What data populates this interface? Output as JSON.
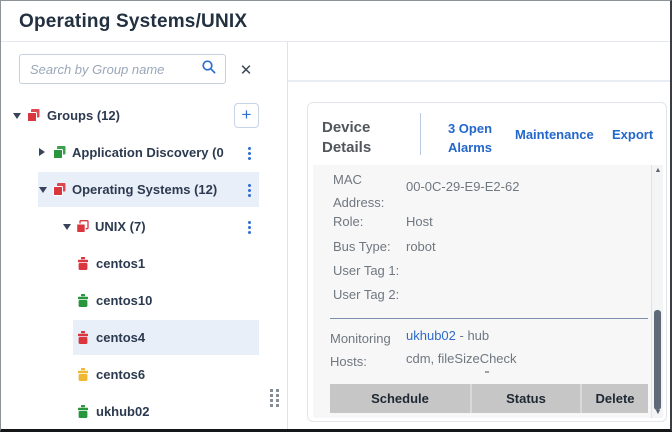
{
  "page_title": "Operating Systems/UNIX",
  "sidebar": {
    "search_placeholder": "Search by Group name",
    "tree": [
      {
        "label": "Groups (12)",
        "status": "red",
        "state": "expanded",
        "selected": false
      },
      {
        "label": "Application Discovery (0",
        "status": "green",
        "state": "collapsed",
        "selected": false
      },
      {
        "label": "Operating Systems (12)",
        "status": "red",
        "state": "expanded",
        "selected": true
      },
      {
        "label": "UNIX (7)",
        "status": "red",
        "state": "expanded",
        "selected": false
      },
      {
        "label": "centos1",
        "status": "red",
        "state": "leaf",
        "selected": false
      },
      {
        "label": "centos10",
        "status": "green",
        "state": "leaf",
        "selected": false
      },
      {
        "label": "centos4",
        "status": "red",
        "state": "leaf",
        "selected": true
      },
      {
        "label": "centos6",
        "status": "yellow",
        "state": "leaf",
        "selected": false
      },
      {
        "label": "ukhub02",
        "status": "green",
        "state": "leaf",
        "selected": false
      }
    ]
  },
  "device_panel": {
    "title": "Device Details",
    "open_alarms_link": "3 Open Alarms",
    "maintenance_link": "Maintenance",
    "export_link": "Export",
    "fields": [
      {
        "label": "MAC Address:",
        "value": "00-0C-29-E9-E2-62"
      },
      {
        "label": "Role:",
        "value": "Host"
      },
      {
        "label": "Bus Type:",
        "value": "robot"
      },
      {
        "label": "User Tag 1:",
        "value": ""
      },
      {
        "label": "User Tag 2:",
        "value": ""
      }
    ],
    "monitoring": {
      "label": "Monitoring Hosts:",
      "host": "ukhub02",
      "suffix": " - hub",
      "probes": "cdm, fileSizeCheck"
    },
    "table_headers": [
      "Schedule",
      "Status",
      "Delete"
    ]
  },
  "icons": {
    "clear_icon": "✕",
    "add_icon": "+",
    "scroll_up_icon": "▲",
    "scroll_down_icon": "▼"
  },
  "colors": {
    "title_text": "#22303f",
    "link_blue": "#2467cb",
    "accent_blue": "#2e6fd0",
    "status_red": "#d9363e",
    "status_green": "#27963c",
    "status_yellow": "#efb832",
    "row_highlight": "#e9eff9",
    "table_header_bg": "#c6c6c6",
    "details_bg": "#f7f7f7"
  }
}
